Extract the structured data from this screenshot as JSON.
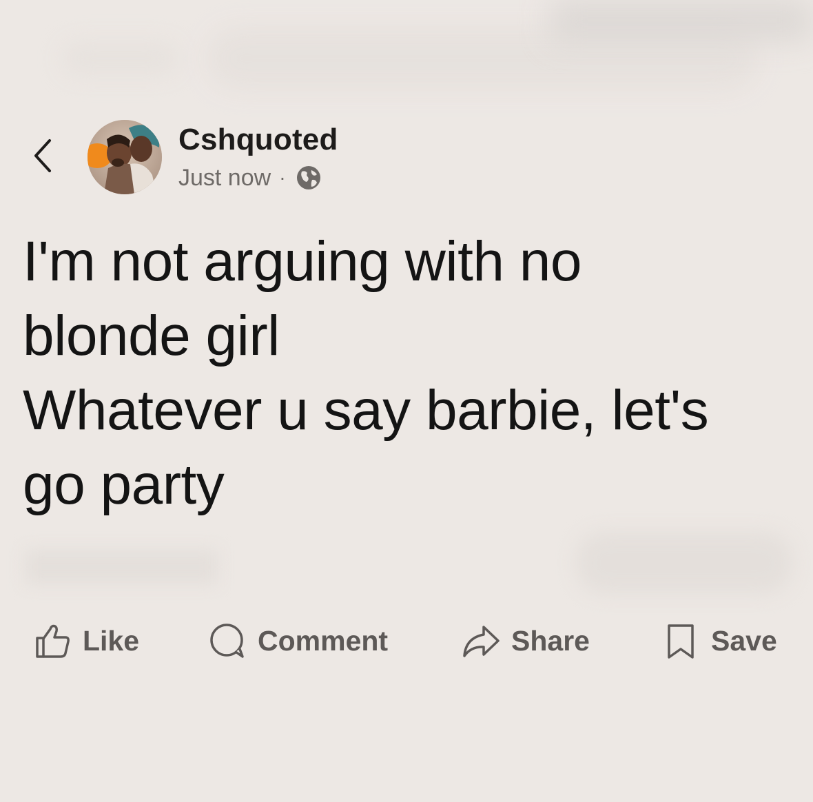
{
  "post": {
    "author": "Cshquoted",
    "time": "Just now",
    "separator": "·",
    "visibility_icon": "globe-icon",
    "text_lines": [
      "I'm not arguing with no",
      "blonde girl",
      "Whatever u say barbie, let's",
      "go party"
    ]
  },
  "actions": {
    "like": {
      "label": "Like",
      "icon": "thumbs-up-icon"
    },
    "comment": {
      "label": "Comment",
      "icon": "comment-icon"
    },
    "share": {
      "label": "Share",
      "icon": "share-icon"
    },
    "save": {
      "label": "Save",
      "icon": "bookmark-icon"
    }
  },
  "colors": {
    "background": "#ede8e4",
    "text": "#141414",
    "muted": "#6e6a67",
    "action": "#5d5957"
  }
}
